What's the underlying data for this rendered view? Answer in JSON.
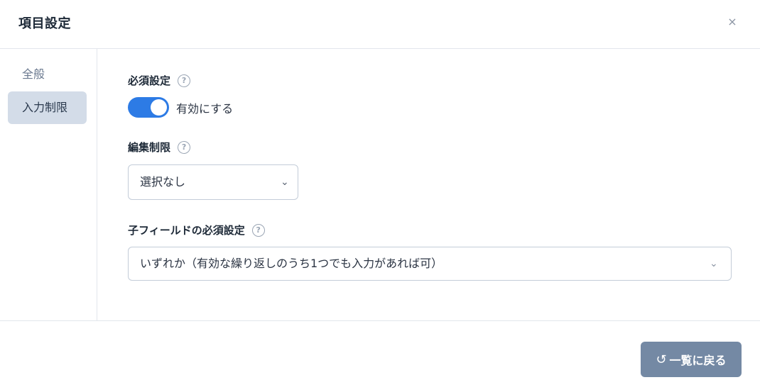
{
  "dialog": {
    "title": "項目設定",
    "close_icon": "×"
  },
  "sidebar": {
    "items": [
      {
        "label": "全般",
        "active": false
      },
      {
        "label": "入力制限",
        "active": true
      }
    ]
  },
  "required": {
    "label": "必須設定",
    "help_icon": "?",
    "toggle_on": true,
    "toggle_label": "有効にする"
  },
  "edit_restriction": {
    "label": "編集制限",
    "help_icon": "?",
    "value": "選択なし"
  },
  "child_required": {
    "label": "子フィールドの必須設定",
    "help_icon": "?",
    "value": "いずれか（有効な繰り返しのうち1つでも入力があれば可）"
  },
  "footer": {
    "back_label": "一覧に戻る",
    "back_icon": "↺"
  },
  "colors": {
    "accent": "#2d7be5",
    "button": "#7489a4",
    "sidebar_active": "#d3dce8"
  }
}
